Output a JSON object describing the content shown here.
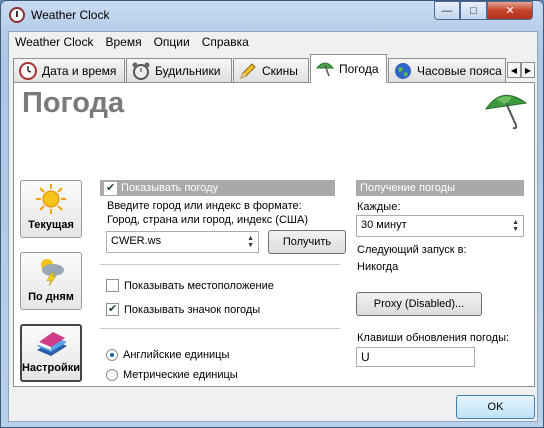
{
  "window": {
    "title": "Weather Clock",
    "min_glyph": "—",
    "max_glyph": "□",
    "close_glyph": "✕"
  },
  "menu": [
    "Weather Clock",
    "Время",
    "Опции",
    "Справка"
  ],
  "tabs": [
    {
      "label": "Дата и время",
      "icon": "clock-icon"
    },
    {
      "label": "Будильники",
      "icon": "alarm-clock-icon"
    },
    {
      "label": "Скины",
      "icon": "pencil-icon"
    },
    {
      "label": "Погода",
      "icon": "umbrella-icon",
      "active": true
    },
    {
      "label": "Часовые пояса",
      "icon": "globe-icon"
    }
  ],
  "tab_scroll": {
    "left": "◀",
    "right": "▶"
  },
  "page_title": "Погода",
  "side_buttons": [
    {
      "label": "Текущая",
      "icon": "sun-icon"
    },
    {
      "label": "По дням",
      "icon": "storm-icon"
    },
    {
      "label": "Настройки",
      "icon": "settings-book-icon",
      "selected": true
    }
  ],
  "weather": {
    "show_weather_label": "Показывать погоду",
    "show_weather_checked": true,
    "instruction": "Введите город или индекс в формате:\nГород, страна или город, индекс (США)",
    "city_value": "CWER.ws",
    "get_button": "Получить",
    "show_location_label": "Показывать местоположение",
    "show_location_checked": false,
    "show_icon_label": "Показывать значок погоды",
    "show_icon_checked": true,
    "units_english": "Английские единицы",
    "units_metric": "Метрические единицы",
    "units_selected": "english"
  },
  "update": {
    "header": "Получение погоды",
    "every_label": "Каждые:",
    "every_value": "30 минут",
    "next_label": "Следующий запуск в:",
    "next_value": "Никогда",
    "proxy_button": "Proxy (Disabled)...",
    "hotkey_label": "Клавиши обновления погоды:",
    "hotkey_value": "U"
  },
  "ok_button": "OK",
  "colors": {
    "accent": "#3c7fb1",
    "group_header": "#a9a9a9",
    "title_gray": "#7a7a7a"
  }
}
